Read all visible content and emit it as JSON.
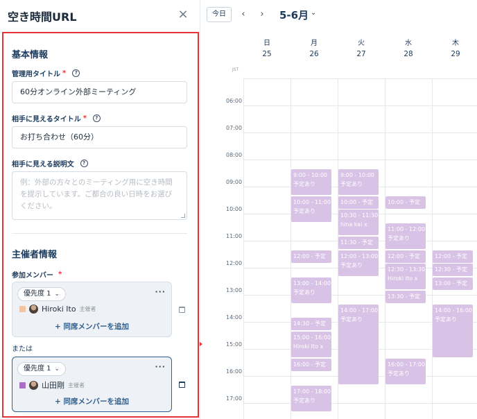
{
  "panel": {
    "title": "空き時間URL",
    "close_symbol": "×",
    "basic_section": "基本情報",
    "admin_title_label": "管理用タイトル",
    "admin_title_value": "60分オンライン外部ミーティング",
    "guest_title_label": "相手に見えるタイトル",
    "guest_title_value": "お打ち合わせ（60分）",
    "guest_desc_label": "相手に見える説明文",
    "guest_desc_placeholder": "例：外部の方々とのミーティング用に空き時間を提示しています。ご都合の良い日時をお選びください。",
    "required_mark": "*",
    "help_symbol": "?",
    "organizer_section": "主催者情報",
    "members_label": "参加メンバー",
    "or_label": "または",
    "cards": [
      {
        "priority": "優先度 1",
        "member": "Hiroki Ito",
        "role": "主催者",
        "color": "#f2c4a0",
        "add": "+ 同席メンバーを追加"
      },
      {
        "priority": "優先度 1",
        "member": "山田剛",
        "role": "主催者",
        "color": "#a86fc4",
        "add": "+ 同席メンバーを追加"
      }
    ]
  },
  "calendar": {
    "today": "今日",
    "prev": "‹",
    "next": "›",
    "month": "5-6月",
    "tz": "JST",
    "days": [
      {
        "dow": "日",
        "date": "25"
      },
      {
        "dow": "月",
        "date": "26"
      },
      {
        "dow": "火",
        "date": "27"
      },
      {
        "dow": "水",
        "date": "28"
      },
      {
        "dow": "木",
        "date": "29"
      }
    ],
    "hours": [
      "06:00",
      "07:00",
      "08:00",
      "09:00",
      "10:00",
      "11:00",
      "12:00",
      "13:00",
      "14:00",
      "15:00",
      "16:00",
      "17:00"
    ],
    "event_color": "#d8c2e6",
    "events": [
      {
        "day": 1,
        "start": 9.0,
        "end": 10.0,
        "title": "9:00 - 10:00",
        "sub": "予定あり"
      },
      {
        "day": 1,
        "start": 10.0,
        "end": 11.0,
        "title": "10:00 - 11:00",
        "sub": "予定あり"
      },
      {
        "day": 1,
        "start": 12.0,
        "end": 12.5,
        "title": "12:00 - 予定",
        "sub": ""
      },
      {
        "day": 1,
        "start": 13.0,
        "end": 14.0,
        "title": "13:00 - 14:00",
        "sub": "予定あり"
      },
      {
        "day": 1,
        "start": 14.5,
        "end": 15.0,
        "title": "14:30 - 予定",
        "sub": ""
      },
      {
        "day": 1,
        "start": 15.0,
        "end": 16.0,
        "title": "15:00 - 16:00",
        "sub": "Hiroki Ito x"
      },
      {
        "day": 1,
        "start": 16.0,
        "end": 16.5,
        "title": "16:00 - 予定",
        "sub": ""
      },
      {
        "day": 1,
        "start": 17.0,
        "end": 18.0,
        "title": "17:00 - 18:00",
        "sub": "予定あり"
      },
      {
        "day": 2,
        "start": 9.0,
        "end": 10.0,
        "title": "9:00 - 10:00",
        "sub": "予定あり"
      },
      {
        "day": 2,
        "start": 10.0,
        "end": 10.5,
        "title": "10:00 - 予定",
        "sub": ""
      },
      {
        "day": 2,
        "start": 10.5,
        "end": 11.5,
        "title": "10:30 - 11:30",
        "sub": "hina kai x"
      },
      {
        "day": 2,
        "start": 11.5,
        "end": 12.0,
        "title": "11:30 - 予定",
        "sub": ""
      },
      {
        "day": 2,
        "start": 12.0,
        "end": 13.0,
        "title": "12:00 - 13:00",
        "sub": "予定あり"
      },
      {
        "day": 2,
        "start": 14.0,
        "end": 17.0,
        "title": "14:00 - 17:00",
        "sub": "予定あり"
      },
      {
        "day": 3,
        "start": 10.0,
        "end": 10.5,
        "title": "10:00 - 予定",
        "sub": ""
      },
      {
        "day": 3,
        "start": 11.0,
        "end": 12.0,
        "title": "11:00 - 12:00",
        "sub": "予定あり"
      },
      {
        "day": 3,
        "start": 12.0,
        "end": 12.5,
        "title": "12:00 - 予定",
        "sub": ""
      },
      {
        "day": 3,
        "start": 12.5,
        "end": 13.5,
        "title": "12:30 - 13:30",
        "sub": "Hiroki Ito x"
      },
      {
        "day": 3,
        "start": 13.5,
        "end": 14.0,
        "title": "13:30 - 予定",
        "sub": ""
      },
      {
        "day": 3,
        "start": 16.0,
        "end": 17.0,
        "title": "16:00 - 17:00",
        "sub": "予定あり"
      },
      {
        "day": 4,
        "start": 12.0,
        "end": 12.5,
        "title": "12:00 - 予定",
        "sub": ""
      },
      {
        "day": 4,
        "start": 12.5,
        "end": 13.0,
        "title": "12:30 - 予定",
        "sub": ""
      },
      {
        "day": 4,
        "start": 13.0,
        "end": 13.5,
        "title": "13:00 - 予定",
        "sub": ""
      },
      {
        "day": 4,
        "start": 14.0,
        "end": 16.0,
        "title": "14:00 - 16:00",
        "sub": "予定あり"
      }
    ]
  }
}
